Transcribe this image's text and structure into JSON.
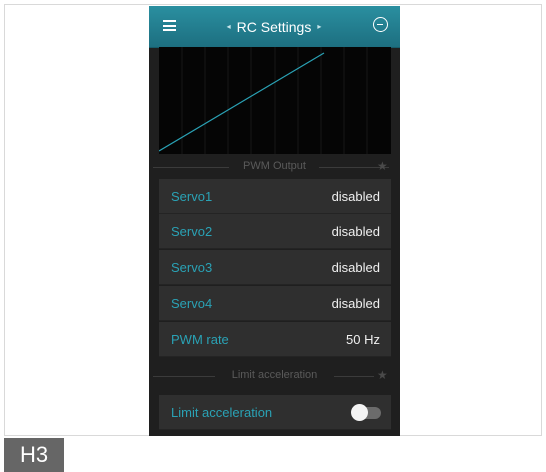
{
  "header": {
    "title": "RC Settings",
    "prev_arrow": "◂",
    "next_arrow": "▸",
    "menu_icon": "hamburger-menu-icon",
    "right_icon": "minus-circle-icon"
  },
  "sections": {
    "pwm_output": {
      "title": "PWM Output",
      "star": "★"
    },
    "limit_acceleration": {
      "title": "Limit acceleration",
      "star": "★"
    }
  },
  "pwm_rows": [
    {
      "label": "Servo1",
      "value": "disabled"
    },
    {
      "label": "Servo2",
      "value": "disabled"
    },
    {
      "label": "Servo3",
      "value": "disabled"
    },
    {
      "label": "Servo4",
      "value": "disabled"
    },
    {
      "label": "PWM rate",
      "value": "50 Hz"
    }
  ],
  "limit_row": {
    "label": "Limit acceleration",
    "toggle_state": "off"
  },
  "tag": "H3",
  "colors": {
    "accent": "#2aa2b5",
    "header": "#2a8fa0",
    "background": "#1f1f1f",
    "row": "#2f2f2f"
  }
}
